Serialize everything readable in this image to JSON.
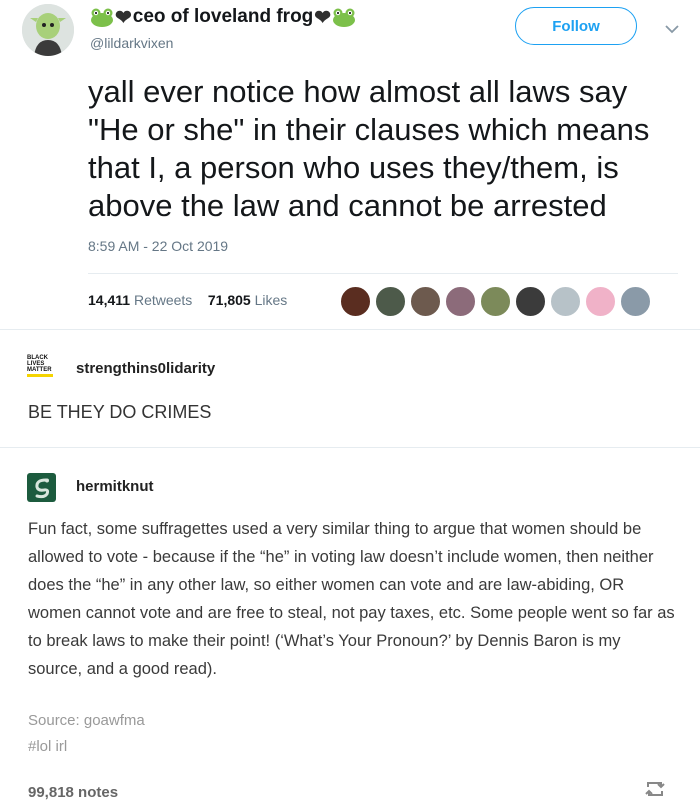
{
  "tweet": {
    "display_name": "ceo of loveland frog",
    "handle": "@lildarkvixen",
    "follow_label": "Follow",
    "text": "yall ever notice how almost all laws say \"He or she\" in their clauses which means that I, a person who uses they/them, is above the law and cannot be arrested",
    "timestamp": "8:59 AM - 22 Oct 2019",
    "retweets_count": "14,411",
    "retweets_label": "Retweets",
    "likes_count": "71,805",
    "likes_label": "Likes",
    "liker_avatars": [
      "avatar-1",
      "avatar-2",
      "avatar-3",
      "avatar-4",
      "avatar-5",
      "avatar-6",
      "avatar-7",
      "avatar-8",
      "avatar-9"
    ],
    "liker_colors": [
      "#5a2d20",
      "#4d5a4a",
      "#6d5a4e",
      "#8c6b7a",
      "#7c8a5a",
      "#3b3b3b",
      "#b7c2c8",
      "#f0b2c8",
      "#8a9aa8"
    ]
  },
  "reblogs": [
    {
      "username": "strengthins0lidarity",
      "logo_text": "BLACK LIVES MATTER",
      "text": "BE THEY DO CRIMES"
    },
    {
      "username": "hermitknut",
      "text": "Fun fact, some suffragettes used a very similar thing to argue that women should be allowed to vote - because if the “he” in voting law doesn’t include women, then neither does the “he” in any other law, so either women can vote and are law-abiding, OR women cannot vote and are free to steal, not pay taxes, etc. Some people went so far as to break laws to make their point! (‘What’s Your Pronoun?’ by Dennis Baron is my source, and a good read)."
    }
  ],
  "footer": {
    "source": "Source: goawfma",
    "tag": "#lol irl",
    "notes": "99,818 notes"
  },
  "colors": {
    "twitter_blue": "#1da1f2",
    "muted": "#657786",
    "slytherin_green": "#1c5b3e"
  }
}
